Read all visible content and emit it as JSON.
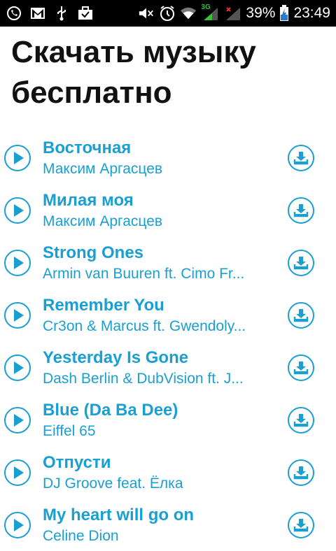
{
  "status_bar": {
    "battery": "39%",
    "time": "23:49",
    "network": "3G",
    "icons": [
      "viber-icon",
      "gmail-icon",
      "usb-icon",
      "briefcase-icon",
      "mute-icon",
      "alarm-icon",
      "wifi-icon",
      "signal-3g-icon",
      "signal-x-icon",
      "battery-charging-icon"
    ]
  },
  "page": {
    "title": "Скачать музыку бесплатно"
  },
  "accent_color": "#1a9fd3",
  "tracks": [
    {
      "title": "Восточная",
      "artist": "Максим Аргасцев"
    },
    {
      "title": "Милая моя",
      "artist": "Максим Аргасцев"
    },
    {
      "title": "Strong Ones",
      "artist": "Armin van Buuren ft. Cimo Fr..."
    },
    {
      "title": "Remember You",
      "artist": "Cr3on & Marcus ft. Gwendoly..."
    },
    {
      "title": "Yesterday Is Gone",
      "artist": "Dash Berlin & DubVision ft. J..."
    },
    {
      "title": "Blue (Da Ba Dee)",
      "artist": "Eiffel 65"
    },
    {
      "title": "Отпусти",
      "artist": "DJ Groove feat. Ёлка"
    },
    {
      "title": "My heart will go on",
      "artist": "Celine Dion"
    }
  ]
}
